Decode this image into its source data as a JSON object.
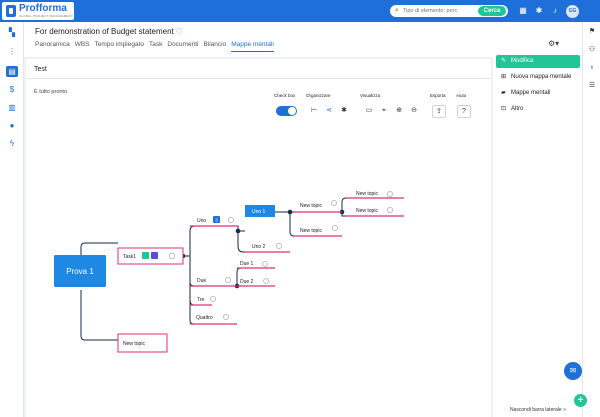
{
  "app": {
    "logo_name": "Profforma",
    "logo_tagline": "GLOBAL PROJECT MANAGEMENT",
    "avatar_initials": "GG"
  },
  "search": {
    "placeholder": "Tipo di elemento: perc",
    "button": "Cerca"
  },
  "page": {
    "title": "For demonstration of Budget statement",
    "tabs": [
      "Panoramica",
      "WBS",
      "Tempo impiegato",
      "Task",
      "Documenti",
      "Bilancio",
      "Mappe mentali"
    ],
    "active_tab": "Mappe mentali"
  },
  "panel": {
    "title": "Test",
    "status": "È tutto pronto"
  },
  "toolbar": {
    "checkbox_label": "Check box",
    "organize_label": "Organizzare",
    "view_label": "Visualizza",
    "export_label": "Esporta",
    "help_label": "Aiuto",
    "checkbox_on": true
  },
  "mindmap": {
    "root": "Prova 1",
    "task1": "Task1",
    "uno": "Uno",
    "due": "Due",
    "tre": "Tre",
    "quattro": "Quattro",
    "selected": "Uno 1",
    "uno2": "Uno 2",
    "due1": "Due 1",
    "due2": "Due 2",
    "nt_a": "New topic",
    "nt_b": "New topic",
    "nt_c": "New topic",
    "nt_d": "New topic",
    "nt_e": "New topic",
    "uno_badge": "3"
  },
  "sidebar": {
    "items": [
      "Modifica",
      "Nuova mappa mentale",
      "Mappe mentali",
      "Altro"
    ],
    "collapse": "Nascondi barra laterale"
  },
  "colors": {
    "brand": "#1e6fd9",
    "accent": "#22c597",
    "node_border": "#e02d7a",
    "root": "#1e88e5"
  }
}
